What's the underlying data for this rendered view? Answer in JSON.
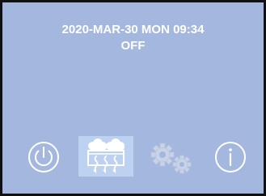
{
  "header": {
    "datetime": "2020-MAR-30 MON 09:34",
    "status": "OFF"
  },
  "toolbar": {
    "icons": [
      "power-icon",
      "climate-icon",
      "settings-icon",
      "info-icon"
    ],
    "selected": "climate-icon"
  },
  "colors": {
    "background": "#a4b7de",
    "selected_tile": "#bdd1f1",
    "icon_white": "#ffffff",
    "icon_dim": "#c9d3e8",
    "border": "#111111"
  }
}
